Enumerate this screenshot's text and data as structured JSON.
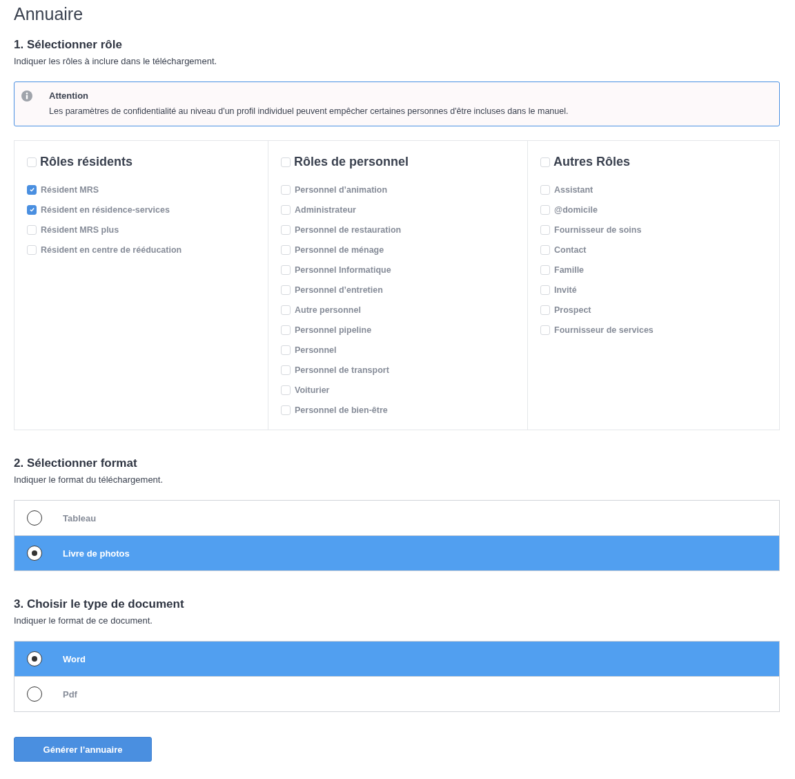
{
  "title": "Annuaire",
  "roles_step": {
    "heading": "1. Sélectionner rôle",
    "description": "Indiquer les rôles à inclure dans le téléchargement.",
    "alert": {
      "title": "Attention",
      "text": "Les paramètres de confidentialité au niveau d'un profil individuel peuvent empêcher certaines personnes d'être incluses dans le manuel."
    },
    "groups": [
      {
        "title": "Rôles résidents",
        "checked": false,
        "roles": [
          {
            "label": "Résident MRS",
            "checked": true
          },
          {
            "label": "Résident en résidence-services",
            "checked": true
          },
          {
            "label": "Résident MRS plus",
            "checked": false
          },
          {
            "label": "Résident en centre de rééducation",
            "checked": false
          }
        ]
      },
      {
        "title": "Rôles de personnel",
        "checked": false,
        "roles": [
          {
            "label": "Personnel d’animation",
            "checked": false
          },
          {
            "label": "Administrateur",
            "checked": false
          },
          {
            "label": "Personnel de restauration",
            "checked": false
          },
          {
            "label": "Personnel de ménage",
            "checked": false
          },
          {
            "label": "Personnel Informatique",
            "checked": false
          },
          {
            "label": "Personnel d’entretien",
            "checked": false
          },
          {
            "label": "Autre personnel",
            "checked": false
          },
          {
            "label": "Personnel pipeline",
            "checked": false
          },
          {
            "label": "Personnel",
            "checked": false
          },
          {
            "label": "Personnel de transport",
            "checked": false
          },
          {
            "label": "Voiturier",
            "checked": false
          },
          {
            "label": "Personnel de bien-être",
            "checked": false
          }
        ]
      },
      {
        "title": "Autres Rôles",
        "checked": false,
        "roles": [
          {
            "label": "Assistant",
            "checked": false
          },
          {
            "label": "@domicile",
            "checked": false
          },
          {
            "label": "Fournisseur de soins",
            "checked": false
          },
          {
            "label": "Contact",
            "checked": false
          },
          {
            "label": "Famille",
            "checked": false
          },
          {
            "label": "Invité",
            "checked": false
          },
          {
            "label": "Prospect",
            "checked": false
          },
          {
            "label": "Fournisseur de services",
            "checked": false
          }
        ]
      }
    ]
  },
  "format_step": {
    "heading": "2. Sélectionner format",
    "description": "Indiquer le format du téléchargement.",
    "options": [
      {
        "label": "Tableau",
        "selected": false
      },
      {
        "label": "Livre de photos",
        "selected": true
      }
    ]
  },
  "document_step": {
    "heading": "3. Choisir le type de document",
    "description": "Indiquer le format de ce document.",
    "options": [
      {
        "label": "Word",
        "selected": true
      },
      {
        "label": "Pdf",
        "selected": false
      }
    ]
  },
  "generate_button": "Générer l’annuaire"
}
